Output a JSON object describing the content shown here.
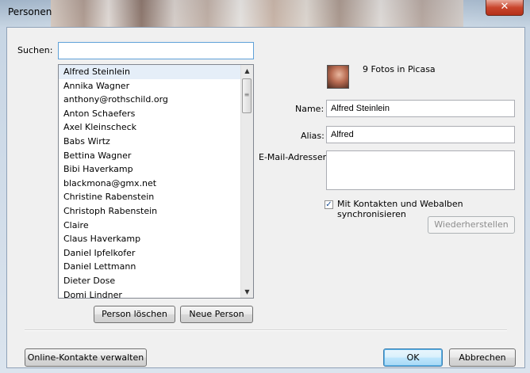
{
  "window": {
    "title": "Personen",
    "close_glyph": "✕"
  },
  "search": {
    "label": "Suchen:",
    "value": ""
  },
  "people_list": [
    "Alfred Steinlein",
    "Annika Wagner",
    "anthony@rothschild.org",
    "Anton Schaefers",
    "Axel Kleinscheck",
    "Babs Wirtz",
    "Bettina Wagner",
    "Bibi Haverkamp",
    "blackmona@gmx.net",
    "Christine Rabenstein",
    "Christoph Rabenstein",
    "Claire",
    "Claus Haverkamp",
    "Daniel Ipfelkofer",
    "Daniel Lettmann",
    "Dieter Dose",
    "Domi Lindner"
  ],
  "list_buttons": {
    "delete": "Person löschen",
    "new": "Neue Person"
  },
  "detail": {
    "photo_count_text": "9 Fotos in Picasa",
    "name_label": "Name:",
    "name_value": "Alfred Steinlein",
    "alias_label": "Alias:",
    "alias_value": "Alfred",
    "email_label": "E-Mail-Adressen:",
    "email_value": "",
    "sync_label": "Mit Kontakten und Webalben synchronisieren",
    "sync_checked": true,
    "restore_button": "Wiederherstellen"
  },
  "footer": {
    "manage_contacts": "Online-Kontakte verwalten",
    "ok": "OK",
    "cancel": "Abbrechen"
  },
  "icons": {
    "avatar": "person-photo-icon",
    "checkmark": "✓",
    "scroll_up": "▲",
    "scroll_down": "▼",
    "grip": "≡"
  }
}
